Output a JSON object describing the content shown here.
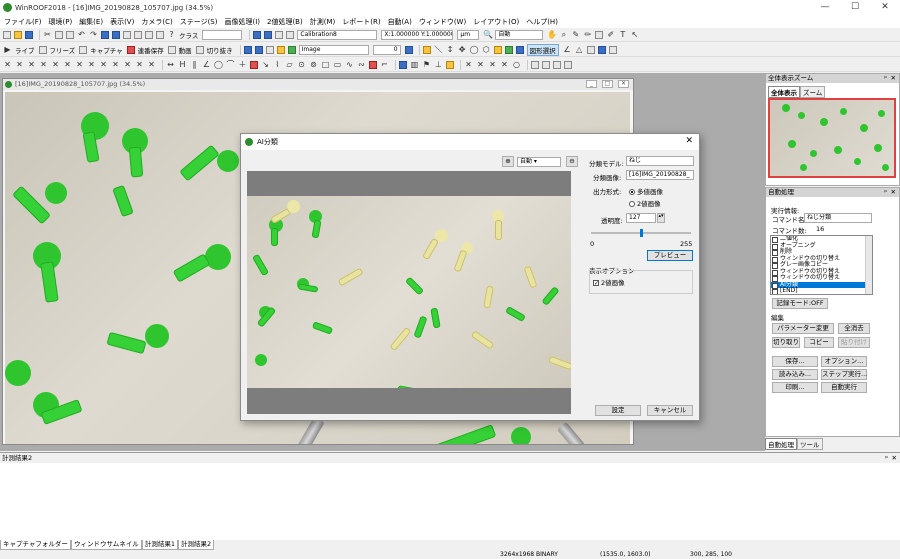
{
  "window": {
    "title": "WinROOF2018 - [16]IMG_20190828_105707.jpg (34.5%)"
  },
  "menu": [
    "ファイル(F)",
    "環境(P)",
    "編集(E)",
    "表示(V)",
    "カメラ(C)",
    "ステージ(S)",
    "画像処理(I)",
    "2値処理(B)",
    "計測(M)",
    "レポート(R)",
    "自動(A)",
    "ウィンドウ(W)",
    "レイアウト(O)",
    "ヘルプ(H)"
  ],
  "toolbar1": {
    "class_label": "クラス",
    "calibration": "Calibration8",
    "scale": "X:1.000000 Y:1.000000",
    "unit": "μm",
    "auto": "自動"
  },
  "toolbar2": {
    "live": "ライブ",
    "freeze": "フリーズ",
    "capture": "キャプチャ",
    "continuous_save": "連番保存",
    "video": "動画",
    "cutout": "切り抜き",
    "image": "Image",
    "zero": "0",
    "shape_select": "図形選択"
  },
  "image_window": {
    "title": "[16]IMG_20190828_105707.jpg (34.5%)"
  },
  "dialog": {
    "title": "AI分類",
    "zoom_mode": "自動",
    "model_label": "分類モデル:",
    "model_value": "ねじ",
    "image_label": "分類画像:",
    "image_value": "[16]IMG_20190828_",
    "output_label": "出力形式:",
    "output_multi": "多値画像",
    "output_binary": "2値画像",
    "opacity_label": "透明度:",
    "opacity_value": "127",
    "slider_min": "0",
    "slider_max": "255",
    "slider_value": 0.5,
    "preview_button": "プレビュー",
    "display_option_label": "表示オプション",
    "display_binary": "2値画像",
    "settings_button": "設定",
    "cancel_button": "キャンセル"
  },
  "right_panel": {
    "overview_title": "全体表示ズーム",
    "tab_overview": "全体表示",
    "tab_zoom": "ズーム",
    "auto_title": "自動処理",
    "exec_condition": "実行情報:",
    "command_name_label": "コマンド名:",
    "command_name_value": "ねじ分類",
    "command_count_label": "コマンド数:",
    "command_count_value": "16",
    "commands": [
      "二値化",
      "オープニング",
      "削除",
      "ウィンドウの切り替え",
      "グレー画像コピー",
      "ウィンドウの切り替え",
      "ウィンドウの切り替え",
      "AI分類",
      "[END]"
    ],
    "selected_index": 7,
    "record_mode": "記録モード:OFF",
    "edit_label": "編集",
    "param_change": "パラメーター変更",
    "delete_all": "全消去",
    "cut": "切り取り",
    "copy": "コピー",
    "paste": "貼り付け",
    "save": "保存...",
    "option": "オプション...",
    "load": "読み込み...",
    "step_exec": "ステップ実行...",
    "print": "印刷...",
    "auto_exec": "自動実行",
    "bottom_tab_auto": "自動処理",
    "bottom_tab_tool": "ツール"
  },
  "bottom_panel": {
    "title": "計測結果2"
  },
  "bottom_tabs": [
    "キャプチャフォルダー",
    "ウィンドウサムネイル",
    "計測結果1",
    "計測結果2"
  ],
  "status": {
    "size": "3264x1968 BINARY",
    "coords": "(1535.0, 1603.0)",
    "values": "300, 285, 100"
  }
}
